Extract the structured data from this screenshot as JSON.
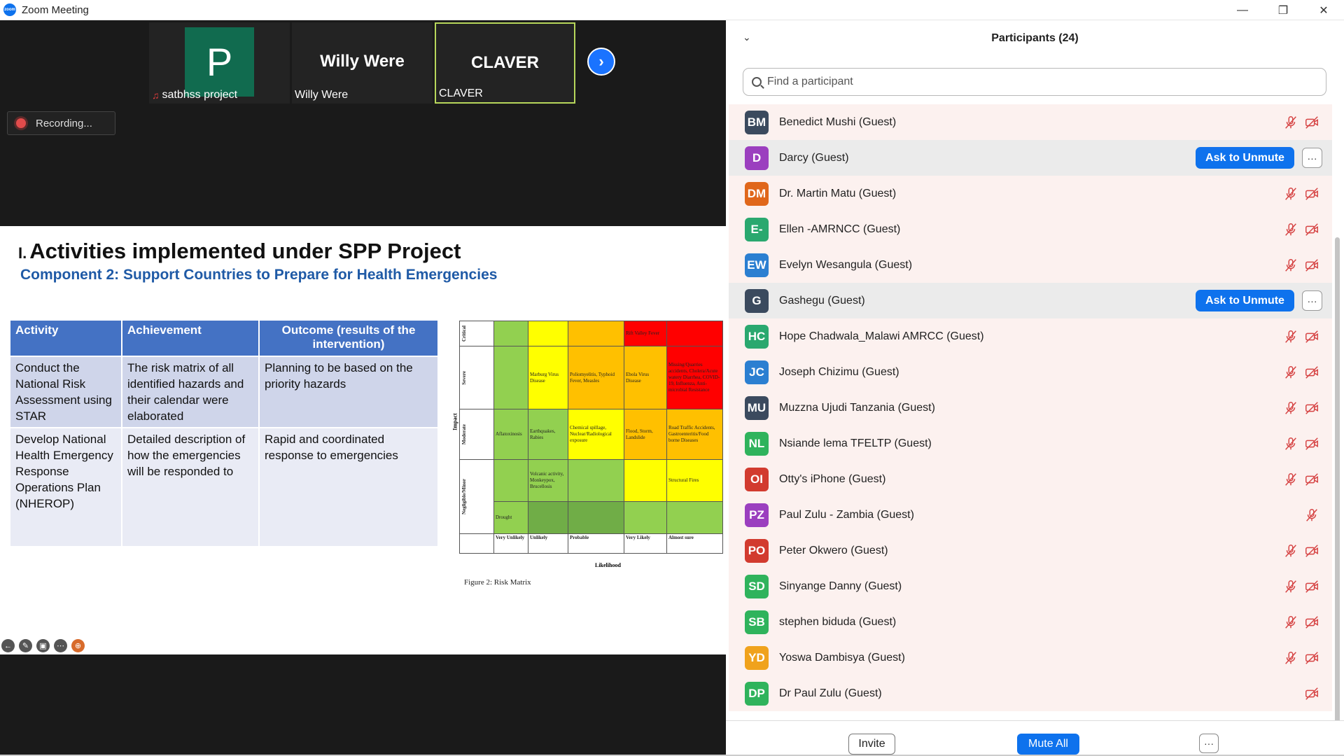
{
  "window": {
    "title": "Zoom Meeting",
    "logo_text": "zoom"
  },
  "strip": {
    "tiles": [
      {
        "initial": "P",
        "name": "satbhss project"
      },
      {
        "display": "Willy Were",
        "name": "Willy Were"
      },
      {
        "display": "CLAVER",
        "name": "CLAVER"
      }
    ]
  },
  "recording": {
    "label": "Recording..."
  },
  "slide": {
    "title_num": "I.",
    "title": "Activities implemented under SPP Project",
    "subtitle": "Component 2: Support Countries to Prepare for Health Emergencies",
    "table": {
      "headers": [
        "Activity",
        "Achievement",
        "Outcome (results of the intervention)"
      ],
      "rows": [
        [
          "Conduct the National Risk Assessment using STAR",
          "The risk matrix of all identified hazards and their calendar were elaborated",
          "Planning to be based on the priority hazards"
        ],
        [
          "Develop National Health Emergency Response Operations Plan (NHEROP)",
          "Detailed description of how the emergencies will be responded to",
          "Rapid and coordinated response to emergencies"
        ]
      ]
    },
    "matrix": {
      "impact_label": "Impact",
      "likelihood_label": "Likelihood",
      "caption": "Figure 2: Risk Matrix",
      "rows": [
        "Critical",
        "Severe",
        "Moderate",
        "Negligible/Minor"
      ],
      "cols": [
        "Very Unlikely",
        "Unlikely",
        "Probable",
        "Very Likely",
        "Almost sure"
      ],
      "cells": {
        "critical_vl": "Rift Valley Fever",
        "severe_u": "Marburg Virus Disease",
        "severe_p": "Poliomyelitis, Typhoid Fever, Measles",
        "severe_vl": "Ebola Virus Disease",
        "severe_as": "Missing/Quarries accidents, Cholera/Acute watery Diarrhea, COVID-19, Influenza, Anti-microbial Resistance",
        "moderate_vu": "Aflatoxinosis",
        "moderate_u": "Earthquakes, Rabies",
        "moderate_p": "Chemical spillage, Nuclear/Radiological exposure",
        "moderate_vl": "Flood, Storm, Landslide",
        "moderate_as": "Road Traffic Accidents, Gastroenteritis/Food borne Diseases",
        "minor_u": "Volcanic activity, Monkeypox, Brucellosis",
        "minor_as": "Structural Fires",
        "neg_vu": "Drought"
      }
    }
  },
  "panel": {
    "title": "Participants (24)",
    "search_placeholder": "Find a participant",
    "ask_unmute": "Ask to Unmute",
    "more": "···",
    "participants": [
      {
        "initials": "BM",
        "name": "Benedict Mushi (Guest)",
        "color": "#3b4a5e"
      },
      {
        "initials": "D",
        "name": "Darcy (Guest)",
        "color": "#9b3fbf"
      },
      {
        "initials": "DM",
        "name": "Dr. Martin Matu (Guest)",
        "color": "#e0671b"
      },
      {
        "initials": "E-",
        "name": "Ellen -AMRNCC (Guest)",
        "color": "#2aa86f"
      },
      {
        "initials": "EW",
        "name": "Evelyn Wesangula (Guest)",
        "color": "#2b7fd1"
      },
      {
        "initials": "G",
        "name": "Gashegu (Guest)",
        "color": "#3b4a5e"
      },
      {
        "initials": "HC",
        "name": "Hope Chadwala_Malawi AMRCC (Guest)",
        "color": "#2aa86f"
      },
      {
        "initials": "JC",
        "name": "Joseph Chizimu (Guest)",
        "color": "#2b7fd1"
      },
      {
        "initials": "MU",
        "name": "Muzzna Ujudi Tanzania (Guest)",
        "color": "#3b4a5e"
      },
      {
        "initials": "NL",
        "name": "Nsiande lema TFELTP (Guest)",
        "color": "#2fb35c"
      },
      {
        "initials": "OI",
        "name": "Otty's iPhone (Guest)",
        "color": "#d23b2f"
      },
      {
        "initials": "PZ",
        "name": "Paul Zulu - Zambia (Guest)",
        "color": "#9b3fbf"
      },
      {
        "initials": "PO",
        "name": "Peter Okwero (Guest)",
        "color": "#d23b2f"
      },
      {
        "initials": "SD",
        "name": "Sinyange Danny (Guest)",
        "color": "#2fb35c"
      },
      {
        "initials": "SB",
        "name": "stephen biduda (Guest)",
        "color": "#2fb35c"
      },
      {
        "initials": "YD",
        "name": "Yoswa Dambisya (Guest)",
        "color": "#f0a21c"
      },
      {
        "initials": "DP",
        "name": "Dr Paul Zulu (Guest)",
        "color": "#2fb35c"
      }
    ],
    "footer": {
      "invite": "Invite",
      "mute_all": "Mute All",
      "more": "···"
    }
  }
}
